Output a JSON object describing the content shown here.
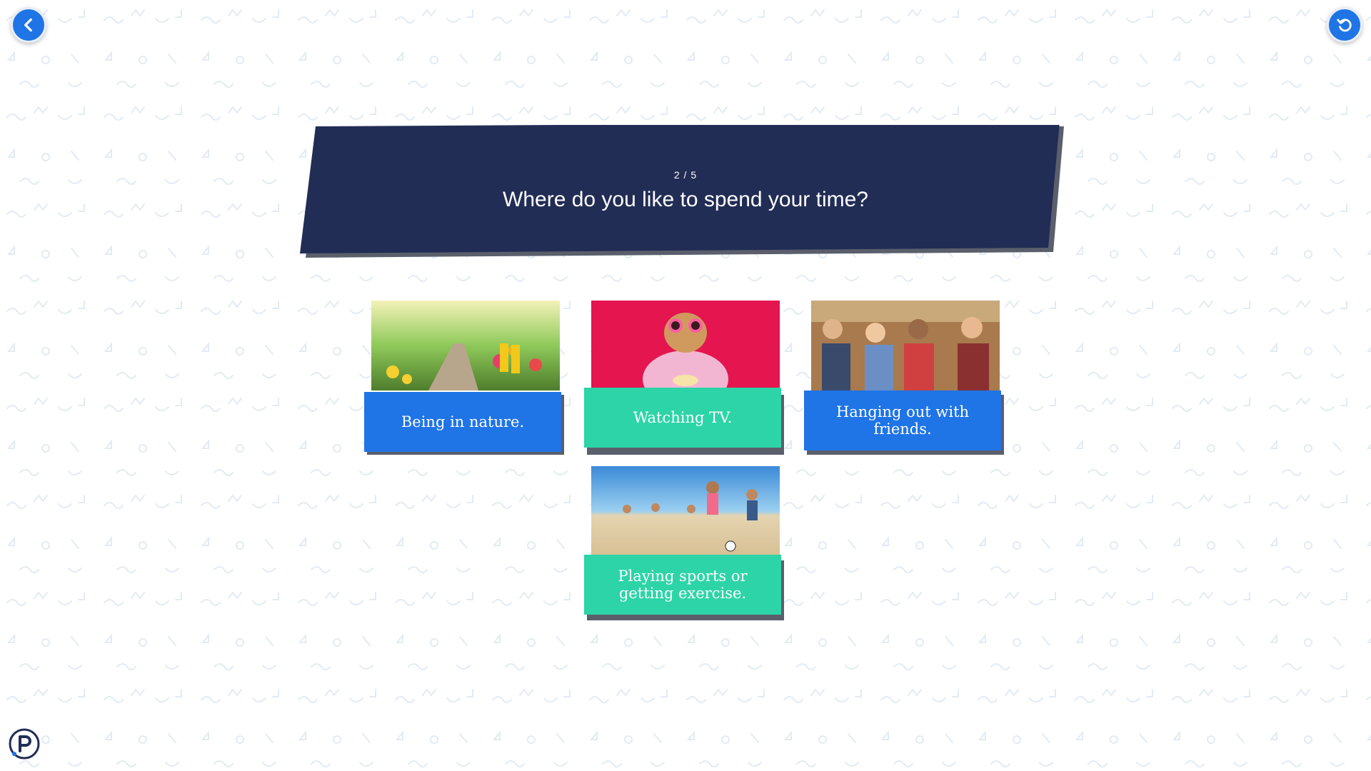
{
  "quiz": {
    "progress": "2 / 5",
    "question": "Where do you like to spend your time?"
  },
  "nav": {
    "back_icon": "chevron-left-icon",
    "restart_icon": "restart-icon"
  },
  "options": [
    {
      "label": "Being in nature.",
      "color": "#1f74e6",
      "image": "garden-path-photo"
    },
    {
      "label": "Watching TV.",
      "color": "#2dd4a7",
      "image": "dog-in-robe-photo"
    },
    {
      "label": "Hanging out with friends.",
      "color": "#1f74e6",
      "image": "friends-party-photo"
    },
    {
      "label": "Playing sports or getting exercise.",
      "color": "#2dd4a7",
      "image": "beach-soccer-photo"
    }
  ],
  "colors": {
    "banner": "#222d55",
    "accent_blue": "#1f74e6",
    "accent_teal": "#2dd4a7"
  },
  "brand": {
    "logo_icon": "p-logo-icon"
  }
}
